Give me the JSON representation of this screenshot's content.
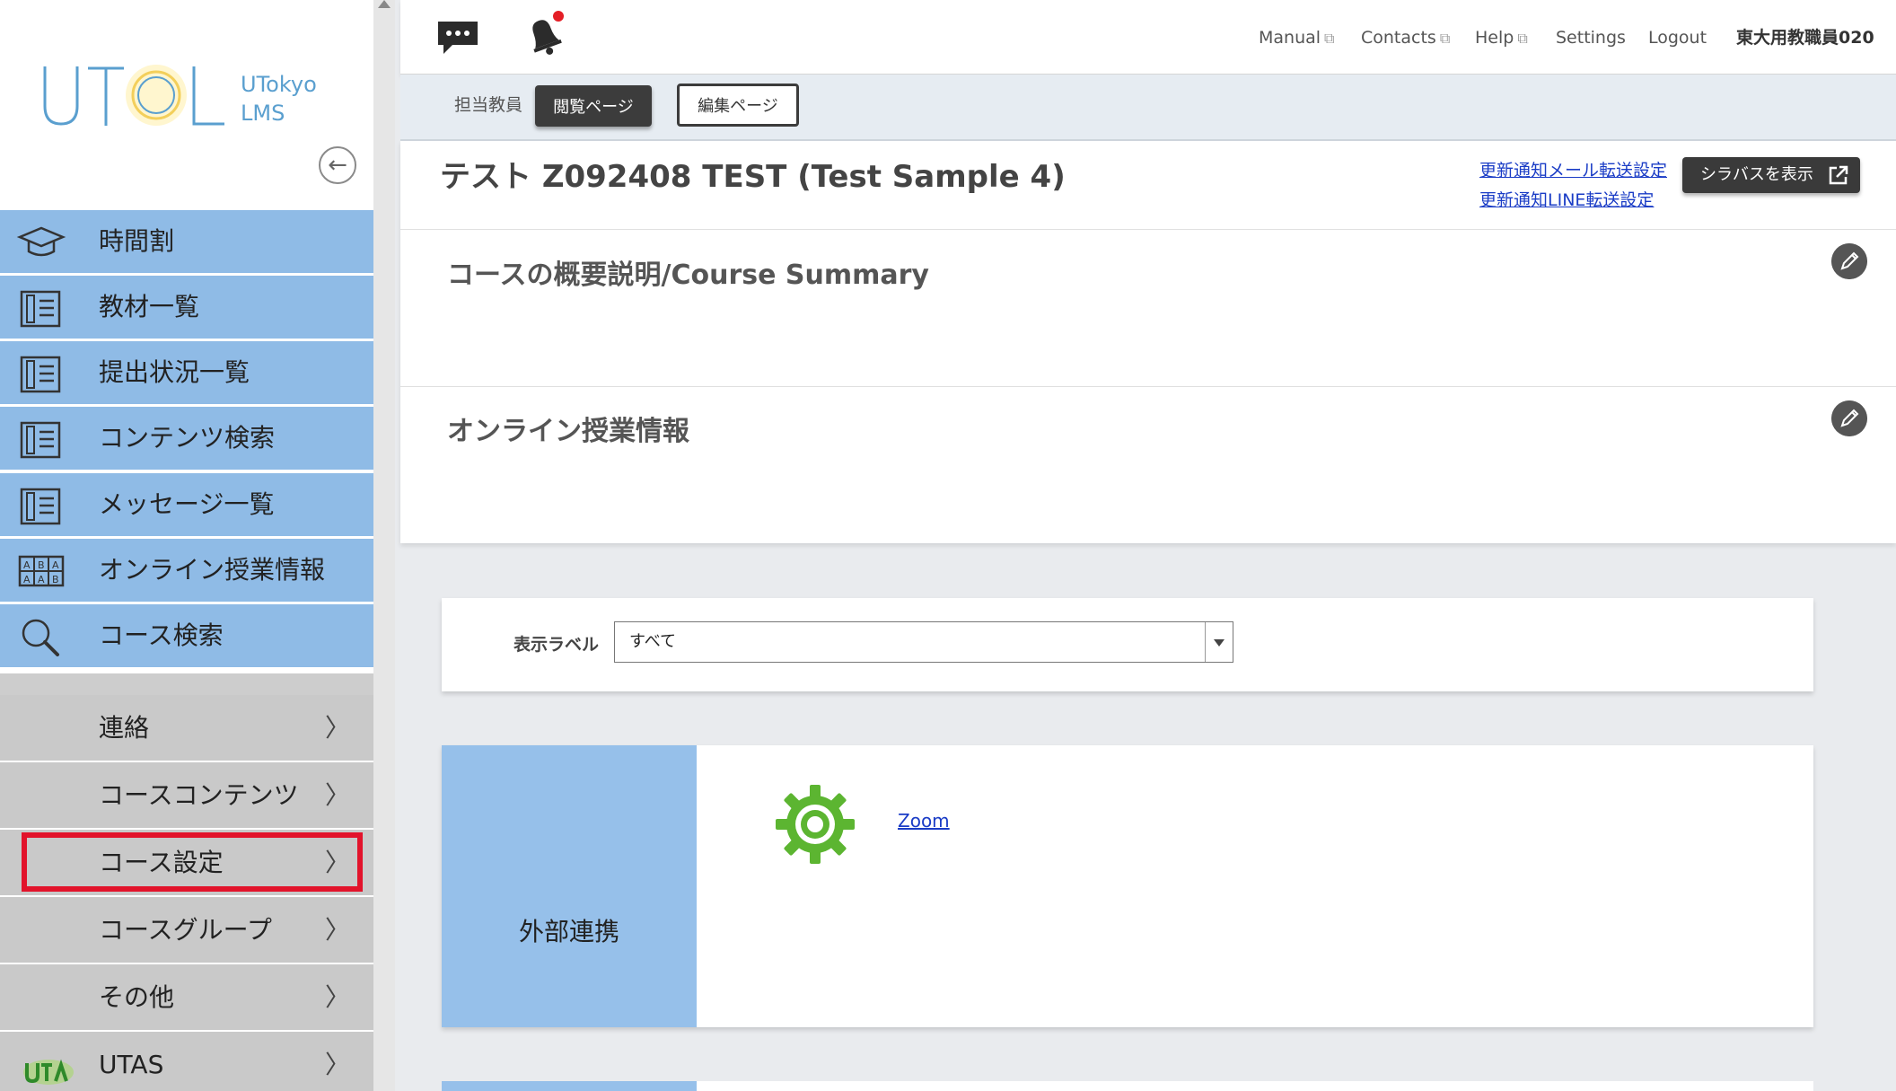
{
  "sidebar": {
    "logo_text": "UTOL",
    "logo_sub1": "UTokyo",
    "logo_sub2": "LMS",
    "collapse_symbol": "←",
    "primary_items": [
      {
        "label": "時間割",
        "icon": "graduation-cap-icon"
      },
      {
        "label": "教材一覧",
        "icon": "document-list-icon"
      },
      {
        "label": "提出状況一覧",
        "icon": "document-list-icon"
      },
      {
        "label": "コンテンツ検索",
        "icon": "document-list-icon"
      },
      {
        "label": "メッセージ一覧",
        "icon": "document-list-icon"
      },
      {
        "label": "オンライン授業情報",
        "icon": "grid-abc-icon"
      },
      {
        "label": "コース検索",
        "icon": "magnifier-icon"
      }
    ],
    "secondary_items": [
      {
        "label": "連絡",
        "chevron": "〉"
      },
      {
        "label": "コースコンテンツ",
        "chevron": "〉"
      },
      {
        "label": "コース設定",
        "chevron": "〉",
        "highlighted": true
      },
      {
        "label": "コースグループ",
        "chevron": "〉"
      },
      {
        "label": "その他",
        "chevron": "〉"
      },
      {
        "label": "UTAS",
        "chevron": "〉",
        "icon": "utas-logo-icon"
      }
    ]
  },
  "header": {
    "links": [
      {
        "label": "Manual",
        "external": true
      },
      {
        "label": "Contacts",
        "external": true
      },
      {
        "label": "Help",
        "external": true
      },
      {
        "label": "Settings",
        "external": false
      },
      {
        "label": "Logout",
        "external": false
      }
    ],
    "user_name": "東大用教職員020",
    "external_symbol": "⧉"
  },
  "subbar": {
    "role_label": "担当教員",
    "tab_view": "閲覧ページ",
    "tab_edit": "編集ページ"
  },
  "course": {
    "title": "テスト Z092408 TEST (Test Sample 4)",
    "notify_mail": "更新通知メール転送設定",
    "notify_line": "更新通知LINE転送設定",
    "syllabus_button": "シラバスを表示",
    "sections": [
      {
        "title": "コースの概要説明/Course Summary"
      },
      {
        "title": "オンライン授業情報"
      }
    ]
  },
  "filter": {
    "label": "表示ラベル",
    "selected": "すべて"
  },
  "integration": {
    "side_label": "外部連携",
    "items": [
      {
        "label": "Zoom",
        "icon": "gear-icon"
      }
    ]
  },
  "colors": {
    "nav_blue": "#8fbbe6",
    "nav_gray": "#c9c9c9",
    "highlight": "#e2132b",
    "link": "#1a3cc6",
    "gear_green": "#5cb531"
  }
}
